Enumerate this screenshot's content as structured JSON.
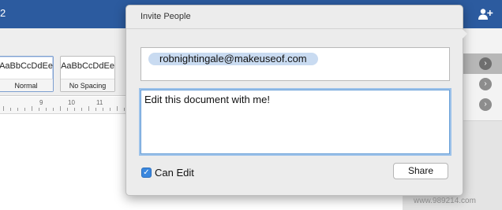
{
  "titlebar": {
    "fragment": "2"
  },
  "ribbon": {
    "styles": [
      {
        "sample": "AaBbCcDdEe",
        "label": "Normal"
      },
      {
        "sample": "AaBbCcDdEe",
        "label": "No Spacing"
      }
    ]
  },
  "ruler": {
    "numbers": [
      "9",
      "10",
      "11"
    ]
  },
  "popover": {
    "title": "Invite People",
    "recipient": "robnightingale@makeuseof.com",
    "message": "Edit this document with me!",
    "can_edit_label": "Can Edit",
    "can_edit_checked": true,
    "share_label": "Share"
  },
  "side_panel": {
    "arrow_glyph": "›"
  },
  "icons": {
    "share_people": "person-add-icon"
  },
  "colors": {
    "titlebar": "#2c5b9f",
    "accent": "#3a87de",
    "token": "#c9dbf1"
  },
  "watermark": "www.989214.com"
}
